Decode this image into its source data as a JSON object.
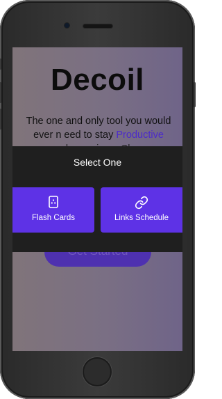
{
  "app": {
    "title": "Decoil",
    "tagline_prefix": "The one and only tool you would ever n eed to stay ",
    "tagline_highlight": "Productive",
    "tagline_obscured": "and organize a Class"
  },
  "cta": {
    "label": "Get Started"
  },
  "sheet": {
    "title": "Select One",
    "options": [
      {
        "label": "Flash Cards",
        "icon": "flash-cards-icon"
      },
      {
        "label": "Links Schedule",
        "icon": "link-icon"
      }
    ]
  },
  "colors": {
    "accent": "#5e32e6",
    "sheet_bg": "#1f1f1f",
    "highlight_text": "#4c2bc9"
  }
}
